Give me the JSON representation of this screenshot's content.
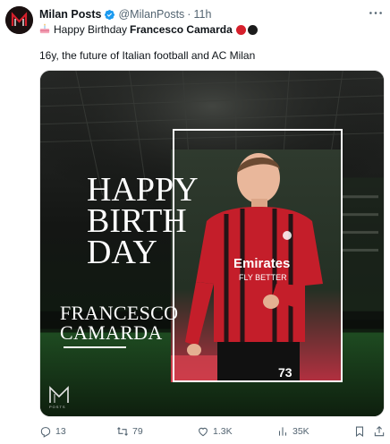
{
  "tweet": {
    "display_name": "Milan Posts",
    "handle": "@MilanPosts",
    "separator": "·",
    "time": "11h",
    "line2_prefix": "Happy Birthday",
    "line2_name": "Francesco Camarda",
    "body": "16y, the future of Italian football and AC Milan"
  },
  "media": {
    "headline": [
      "HAPPY",
      "BIRTH",
      "DAY"
    ],
    "player_name": [
      "FRANCESCO",
      "CAMARDA"
    ],
    "sponsor": "Emirates",
    "sponsor_sub": "FLY BETTER",
    "number": "73",
    "brand_sub": "POSTS"
  },
  "actions": {
    "replies": "13",
    "reposts": "79",
    "likes": "1.3K",
    "views": "35K"
  },
  "icons": [
    "verified-icon",
    "more-icon",
    "birthday-cake-icon",
    "reply-icon",
    "repost-icon",
    "like-icon",
    "views-icon",
    "bookmark-icon",
    "share-icon"
  ],
  "colors": {
    "accent_blue": "#1d9bf0",
    "milan_red": "#d6202c",
    "milan_black": "#1b1b1b"
  }
}
